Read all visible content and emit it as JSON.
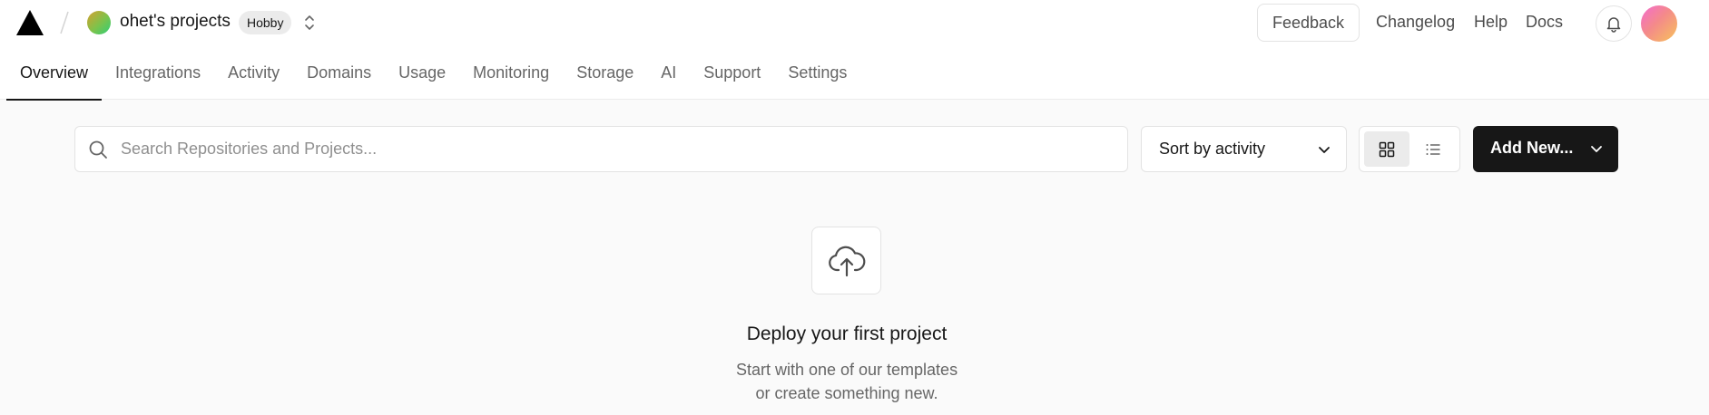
{
  "header": {
    "logo_icon": "vercel-triangle-icon",
    "scope_name": "ohet's projects",
    "plan_badge": "Hobby",
    "feedback_label": "Feedback",
    "links": [
      "Changelog",
      "Help",
      "Docs"
    ],
    "bell_icon": "bell-icon"
  },
  "tabs": {
    "items": [
      "Overview",
      "Integrations",
      "Activity",
      "Domains",
      "Usage",
      "Monitoring",
      "Storage",
      "AI",
      "Support",
      "Settings"
    ],
    "active": "Overview"
  },
  "toolbar": {
    "search_placeholder": "Search Repositories and Projects...",
    "sort_label": "Sort by activity",
    "view_modes": [
      "grid",
      "list"
    ],
    "active_view": "grid",
    "add_new_label": "Add New..."
  },
  "empty_state": {
    "icon": "upload-cloud-icon",
    "title": "Deploy your first project",
    "description_line1": "Start with one of our templates",
    "description_line2": "or create something new."
  },
  "colors": {
    "background": "#fafafa",
    "text": "#171717",
    "muted": "#666666",
    "border": "#e3e3e3",
    "primary_button": "#171717"
  }
}
